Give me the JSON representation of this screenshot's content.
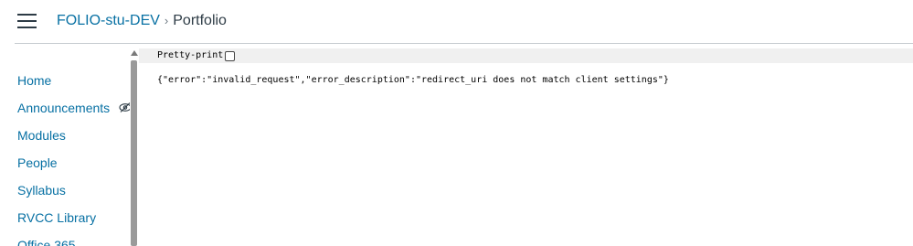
{
  "header": {
    "course_link": "FOLIO-stu-DEV",
    "separator": "›",
    "current_page": "Portfolio"
  },
  "sidebar": {
    "items": [
      {
        "label": "Home"
      },
      {
        "label": "Announcements",
        "icon": "eye-slash-icon"
      },
      {
        "label": "Modules"
      },
      {
        "label": "People"
      },
      {
        "label": "Syllabus"
      },
      {
        "label": "RVCC Library"
      },
      {
        "label": "Office 365"
      }
    ]
  },
  "viewer": {
    "pretty_print_label": "Pretty-print",
    "pretty_print_checked": false,
    "response_text": "{\"error\":\"invalid_request\",\"error_description\":\"redirect_uri does not match client settings\"}"
  },
  "colors": {
    "link": "#0770a3",
    "text": "#2d3b45",
    "scroll_thumb": "#9a9a9a",
    "toolbar_bg": "#f0f0f0"
  }
}
